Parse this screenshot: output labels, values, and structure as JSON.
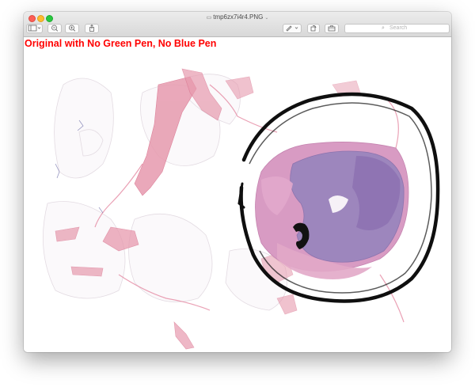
{
  "window": {
    "title": "tmp6zx7i4r4.PNG",
    "title_icon": "document-icon",
    "title_chevron": "chevron-down-icon"
  },
  "toolbar": {
    "sidebar_icon": "sidebar-icon",
    "zoom_out_icon": "zoom-out-icon",
    "zoom_in_icon": "zoom-in-icon",
    "share_icon": "share-icon",
    "markup_icon": "pen-icon",
    "rotate_icon": "rotate-icon",
    "toolbox_icon": "toolbox-icon",
    "search_placeholder": "Search"
  },
  "image": {
    "overlay_text": "Original with No Green Pen, No Blue Pen",
    "overlay_color": "#ff0000"
  }
}
